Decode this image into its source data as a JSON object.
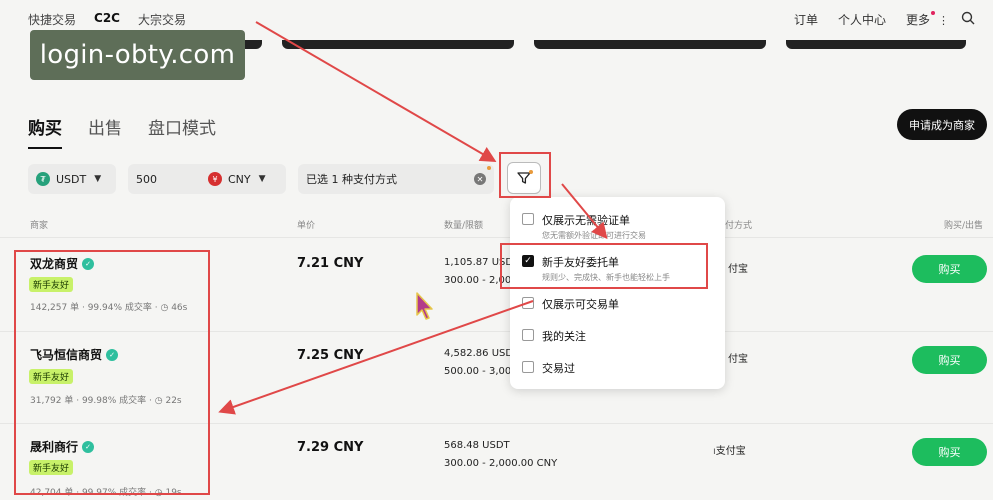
{
  "topnav": {
    "left": [
      "快捷交易",
      "C2C",
      "大宗交易"
    ],
    "right": {
      "orders": "订单",
      "profile": "个人中心",
      "more": "更多"
    }
  },
  "watermark": "login-obty.com",
  "tabs": [
    "购买",
    "出售",
    "盘口模式"
  ],
  "merchant_button": "申请成为商家",
  "filters": {
    "coin": "USDT",
    "amount": "500",
    "fiat": "CNY",
    "payment": "已选 1 种支付方式"
  },
  "table_headers": {
    "merchant": "商家",
    "price": "单价",
    "quantity": "数量/限额",
    "payment": "付方式",
    "action": "购买/出售"
  },
  "rows": [
    {
      "name": "双龙商贸",
      "badge": "新手友好",
      "orders": "142,257 单",
      "rate": "99.94% 成交率",
      "time": "46s",
      "price": "7.21 CNY",
      "qty": "1,105.87 USDT",
      "limit": "300.00 - 2,00",
      "pay": "付宝",
      "action": "购买"
    },
    {
      "name": "飞马恒信商贸",
      "badge": "新手友好",
      "orders": "31,792 单",
      "rate": "99.98% 成交率",
      "time": "22s",
      "price": "7.25 CNY",
      "qty": "4,582.86 USD",
      "limit": "500.00 - 3,00",
      "pay": "付宝",
      "action": "购买"
    },
    {
      "name": "晟利商行",
      "badge": "新手友好",
      "orders": "42,704 单",
      "rate": "99.97% 成交率",
      "time": "19s",
      "price": "7.29 CNY",
      "qty": "568.48 USDT",
      "limit": "300.00 - 2,000.00 CNY",
      "pay": "支付宝",
      "action": "购买"
    }
  ],
  "dropdown": [
    {
      "label": "仅展示无需验证单",
      "sub": "您无需额外验证即可进行交易",
      "checked": false
    },
    {
      "label": "新手友好委托单",
      "sub": "规则少、完成快、新手也能轻松上手",
      "checked": true
    },
    {
      "label": "仅展示可交易单",
      "sub": "",
      "checked": false
    },
    {
      "label": "我的关注",
      "sub": "",
      "checked": false
    },
    {
      "label": "交易过",
      "sub": "",
      "checked": false
    }
  ],
  "colors": {
    "buy": "#1dbd5e",
    "badge": "#c8f169",
    "annotation": "#e04848"
  }
}
